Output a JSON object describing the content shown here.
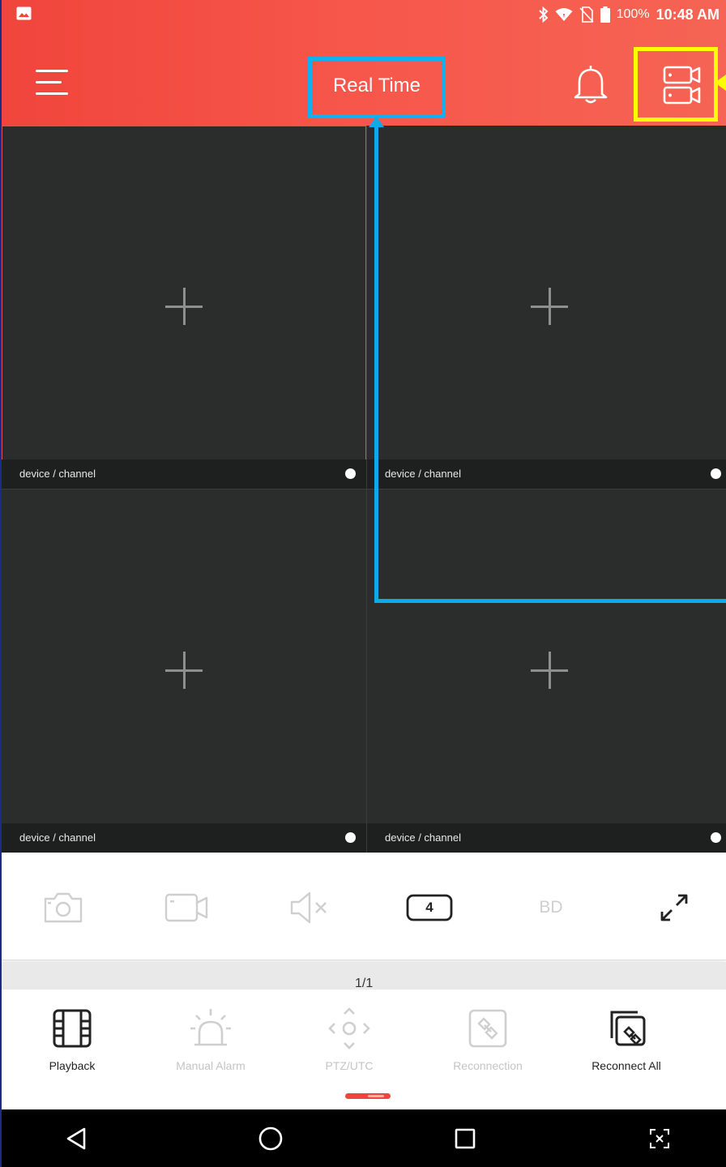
{
  "status_bar": {
    "battery_text": "100%",
    "time": "10:48 AM"
  },
  "header": {
    "title": "Real Time",
    "accent_color": "#f0453c"
  },
  "annotations": {
    "title_highlight_color": "#0fb2ef",
    "device_button_highlight_color": "#ffff00"
  },
  "video_grid": {
    "cells": [
      {
        "label": "device / channel",
        "selected": true
      },
      {
        "label": "device / channel",
        "selected": false
      },
      {
        "label": "device / channel",
        "selected": false
      },
      {
        "label": "device / channel",
        "selected": false
      }
    ]
  },
  "toolbar": {
    "icons": [
      "camera-icon",
      "record-icon",
      "mute-icon",
      "split-screen-icon",
      "stream-quality",
      "fullscreen-icon"
    ],
    "split_count": "4",
    "quality_label": "BD"
  },
  "pager": {
    "text": "1/1"
  },
  "bottom_nav": {
    "items": [
      {
        "label": "Playback",
        "icon": "film-icon",
        "enabled": true
      },
      {
        "label": "Manual Alarm",
        "icon": "alarm-light-icon",
        "enabled": false
      },
      {
        "label": "PTZ/UTC",
        "icon": "ptz-icon",
        "enabled": false
      },
      {
        "label": "Reconnection",
        "icon": "link-icon",
        "enabled": false
      },
      {
        "label": "Reconnect All",
        "icon": "reconnect-all-icon",
        "enabled": true
      }
    ]
  },
  "system_nav": {
    "icons": [
      "back-icon",
      "home-icon",
      "recents-icon",
      "screenshot-icon"
    ]
  }
}
